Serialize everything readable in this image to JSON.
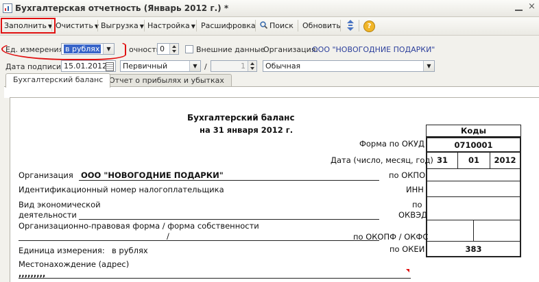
{
  "window": {
    "title": "Бухгалтерская отчетность (Январь 2012 г.) *",
    "close": "×"
  },
  "toolbar": {
    "fill": "Заполнить",
    "clear": "Очистить",
    "export": "Выгрузка",
    "settings": "Настройка",
    "decode": "Расшифровка",
    "search": "Поиск",
    "refresh": "Обновить",
    "help": "?"
  },
  "form": {
    "unit_label": "Ед. измерения:",
    "unit_value": "в рублях",
    "precision_label": "очность:",
    "precision_value": "0",
    "external_label": "Внешние данные",
    "org_label": "Организация:",
    "org_value": "ООО \"НОВОГОДНИЕ ПОДАРКИ\"",
    "sign_date_label": "Дата подписи:",
    "sign_date_value": "15.01.2012",
    "report_kind": "Первичный",
    "slash": "/",
    "correction_no": "1",
    "mode": "Обычная"
  },
  "tabs": [
    "Бухгалтерский баланс",
    "Отчет о прибылях и убытках"
  ],
  "doc": {
    "title": "Бухгалтерский баланс",
    "subtitle": "на 31 января 2012 г.",
    "codes_header": "Коды",
    "okud_label": "Форма по ОКУД",
    "okud_value": "0710001",
    "date_label": "Дата (число, месяц, год)",
    "date_day": "31",
    "date_month": "01",
    "date_year": "2012",
    "org_label": "Организация",
    "org_value": "ООО \"НОВОГОДНИЕ ПОДАРКИ\"",
    "okpo_label": "по ОКПО",
    "inn_text": "Идентификационный номер налогоплательщика",
    "inn_label": "ИНН",
    "activity_line1": "Вид экономической",
    "activity_line2": "деятельности",
    "okved_label1": "по",
    "okved_label2": "ОКВЭД",
    "legal_form_text": "Организационно-правовая форма / форма собственности",
    "legal_form_slash": "/",
    "okopf_label": "по ОКОПФ / ОКФС",
    "unit_text": "Единица измерения:",
    "unit_value": "в рублях",
    "okei_label": "по ОКЕИ",
    "okei_value": "383",
    "address_label": "Местонахождение (адрес)",
    "address_value": ",,,,,,,,,"
  },
  "colors": {
    "accent_red": "#e01010",
    "selection": "#3865c9",
    "link": "#2c3f9b"
  }
}
